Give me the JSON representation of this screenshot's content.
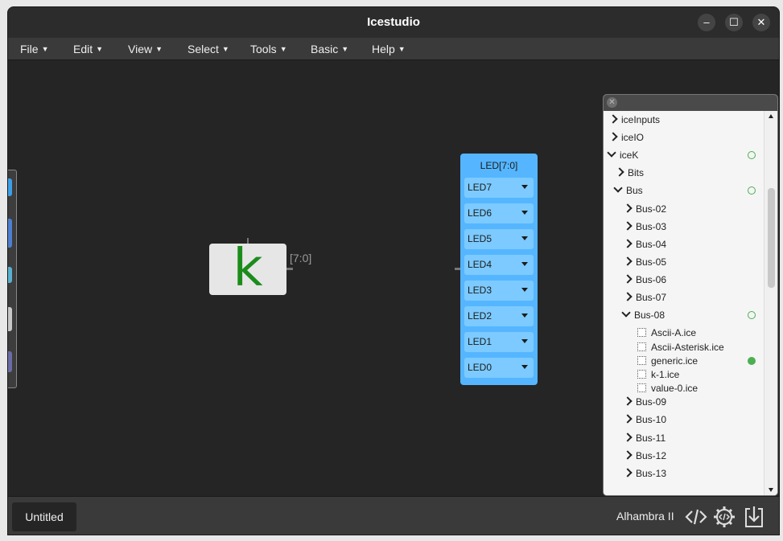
{
  "window": {
    "title": "Icestudio",
    "controls": {
      "minimize": "–",
      "maximize": "☐",
      "close": "✕"
    }
  },
  "menu": [
    "File",
    "Edit",
    "View",
    "Select",
    "Tools",
    "Basic",
    "Help"
  ],
  "canvas": {
    "k_block": {
      "letter": "k",
      "range_label": "[7:0]"
    },
    "led_block": {
      "title": "LED[7:0]",
      "pins": [
        "LED7",
        "LED6",
        "LED5",
        "LED4",
        "LED3",
        "LED2",
        "LED1",
        "LED0"
      ]
    }
  },
  "collection_panel": {
    "close_icon": "x-circle-icon",
    "items": [
      {
        "label": "iceInputs",
        "type": "folder",
        "expanded": false
      },
      {
        "label": "iceIO",
        "type": "folder",
        "expanded": false
      },
      {
        "label": "iceK",
        "type": "folder",
        "expanded": true,
        "indicator": "ring"
      },
      {
        "label": "Bits",
        "type": "folder",
        "expanded": false
      },
      {
        "label": "Bus",
        "type": "folder",
        "expanded": true,
        "indicator": "ring"
      },
      {
        "label": "Bus-02",
        "type": "folder",
        "expanded": false
      },
      {
        "label": "Bus-03",
        "type": "folder",
        "expanded": false
      },
      {
        "label": "Bus-04",
        "type": "folder",
        "expanded": false
      },
      {
        "label": "Bus-05",
        "type": "folder",
        "expanded": false
      },
      {
        "label": "Bus-06",
        "type": "folder",
        "expanded": false
      },
      {
        "label": "Bus-07",
        "type": "folder",
        "expanded": false
      },
      {
        "label": "Bus-08",
        "type": "folder",
        "expanded": true,
        "indicator": "ring"
      },
      {
        "label": "Ascii-A.ice",
        "type": "file"
      },
      {
        "label": "Ascii-Asterisk.ice",
        "type": "file"
      },
      {
        "label": "generic.ice",
        "type": "file",
        "indicator": "filled"
      },
      {
        "label": "k-1.ice",
        "type": "file"
      },
      {
        "label": "value-0.ice",
        "type": "file"
      },
      {
        "label": "Bus-09",
        "type": "folder",
        "expanded": false
      },
      {
        "label": "Bus-10",
        "type": "folder",
        "expanded": false
      },
      {
        "label": "Bus-11",
        "type": "folder",
        "expanded": false
      },
      {
        "label": "Bus-12",
        "type": "folder",
        "expanded": false
      },
      {
        "label": "Bus-13",
        "type": "folder",
        "expanded": false
      }
    ]
  },
  "footer": {
    "tab_label": "Untitled",
    "board_name": "Alhambra II",
    "icons": [
      "code-icon",
      "gear-code-icon",
      "download-icon"
    ]
  },
  "colors": {
    "accent": "#55b6ff",
    "green": "#1b8c1b",
    "indicator": "#4caf50"
  }
}
